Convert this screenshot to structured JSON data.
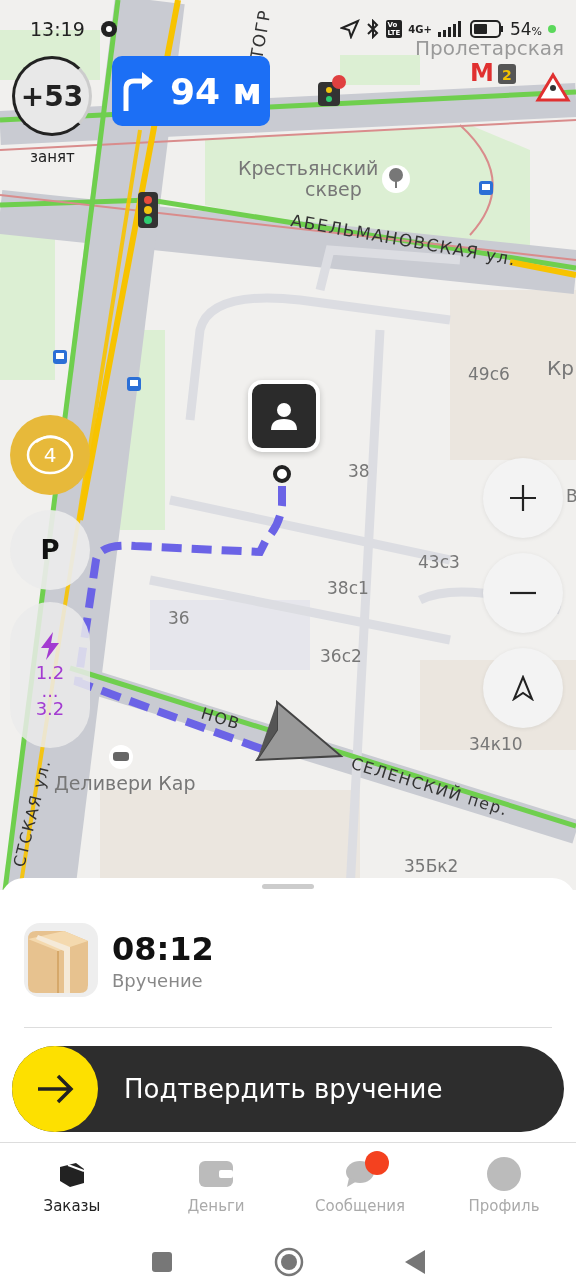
{
  "status_bar": {
    "time": "13:19",
    "volte": [
      "Vo",
      "LTE"
    ],
    "network": "4G+",
    "battery": "54",
    "battery_unit": "%"
  },
  "traffic": {
    "score": "+53",
    "caption": "занят"
  },
  "maneuver": {
    "distance": "94 м"
  },
  "map": {
    "metro_logo": "М",
    "metro_line": "2",
    "labels": [
      {
        "kind": "station",
        "text": "Пролетарская"
      },
      {
        "kind": "place",
        "text": "Крестьянский"
      },
      {
        "kind": "place",
        "text": "сквер"
      },
      {
        "kind": "street",
        "text": "АБЕЛЬМАНОВСКАЯ ул."
      },
      {
        "kind": "street",
        "text": "ТОГР"
      },
      {
        "kind": "building",
        "text": "49с6"
      },
      {
        "kind": "place",
        "text": "Кр"
      },
      {
        "kind": "building",
        "text": "38"
      },
      {
        "kind": "place",
        "text": "В"
      },
      {
        "kind": "building",
        "text": "43с3"
      },
      {
        "kind": "building",
        "text": "38с1"
      },
      {
        "kind": "building",
        "text": "36"
      },
      {
        "kind": "building",
        "text": "36с2"
      },
      {
        "kind": "building",
        "text": "34к10"
      },
      {
        "kind": "street",
        "text": "НОВ"
      },
      {
        "kind": "street",
        "text": "СЕЛЕНСКИЙ пер."
      },
      {
        "kind": "street",
        "text": "СТСКАЯ ул."
      },
      {
        "kind": "place",
        "text": "Деливери Кар"
      },
      {
        "kind": "building",
        "text": "35Бк2"
      }
    ]
  },
  "left_buttons": {
    "cameras": "4",
    "parking": "P",
    "charging": {
      "min": "1.2",
      "separator": "...",
      "max": "3.2"
    }
  },
  "sheet": {
    "time": "08:12",
    "subtitle": "Вручение",
    "confirm": "Подтвердить вручение",
    "slider": {
      "level": 0
    }
  },
  "tabs": [
    {
      "label": "Заказы",
      "selected": true,
      "badge": false
    },
    {
      "label": "Деньги",
      "selected": false,
      "badge": false
    },
    {
      "label": "Сообщения",
      "selected": false,
      "badge": true
    },
    {
      "label": "Профиль",
      "selected": false,
      "badge": false
    }
  ]
}
